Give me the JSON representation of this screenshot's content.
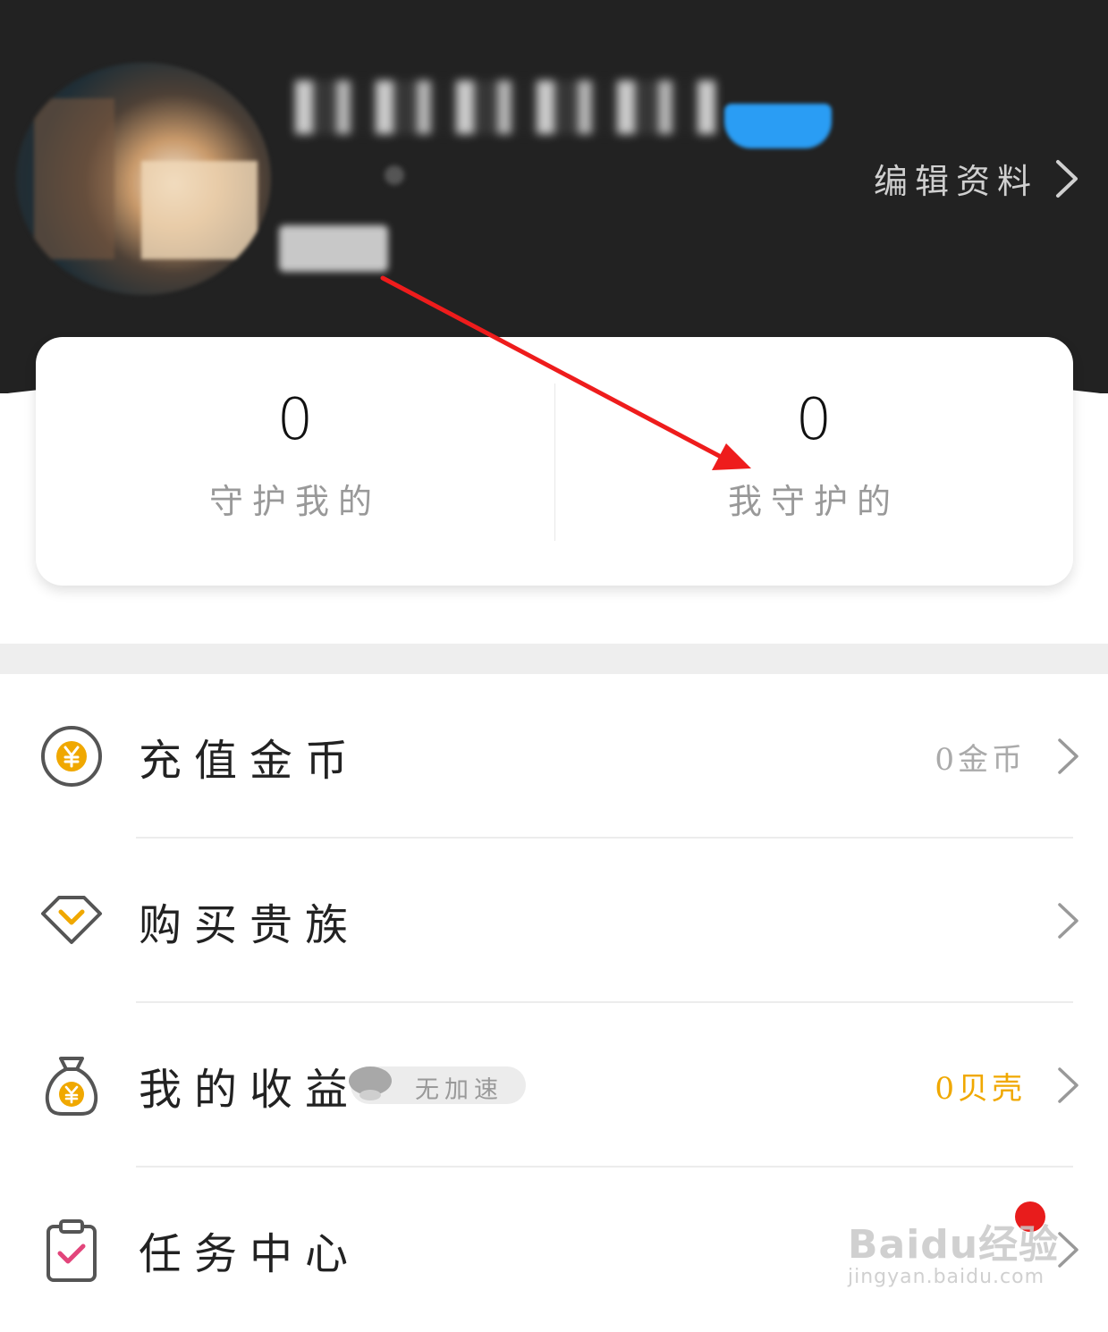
{
  "header": {
    "edit_profile_label": "编辑资料"
  },
  "stats": [
    {
      "value": "0",
      "label": "守护我的"
    },
    {
      "value": "0",
      "label": "我守护的"
    }
  ],
  "menu": {
    "recharge": {
      "label": "充值金币",
      "value": "0金币"
    },
    "nobility": {
      "label": "购买贵族"
    },
    "earnings": {
      "label": "我的收益",
      "badge": "无加速",
      "value": "0贝壳"
    },
    "tasks": {
      "label": "任务中心"
    }
  },
  "watermark": {
    "brand": "Baidu经验",
    "url": "jingyan.baidu.com"
  },
  "colors": {
    "header_bg": "#222222",
    "accent_gold": "#f0a800",
    "accent_pink": "#e2457b",
    "annotation_red": "#ee1c1c",
    "notification_red": "#e81c1c"
  }
}
